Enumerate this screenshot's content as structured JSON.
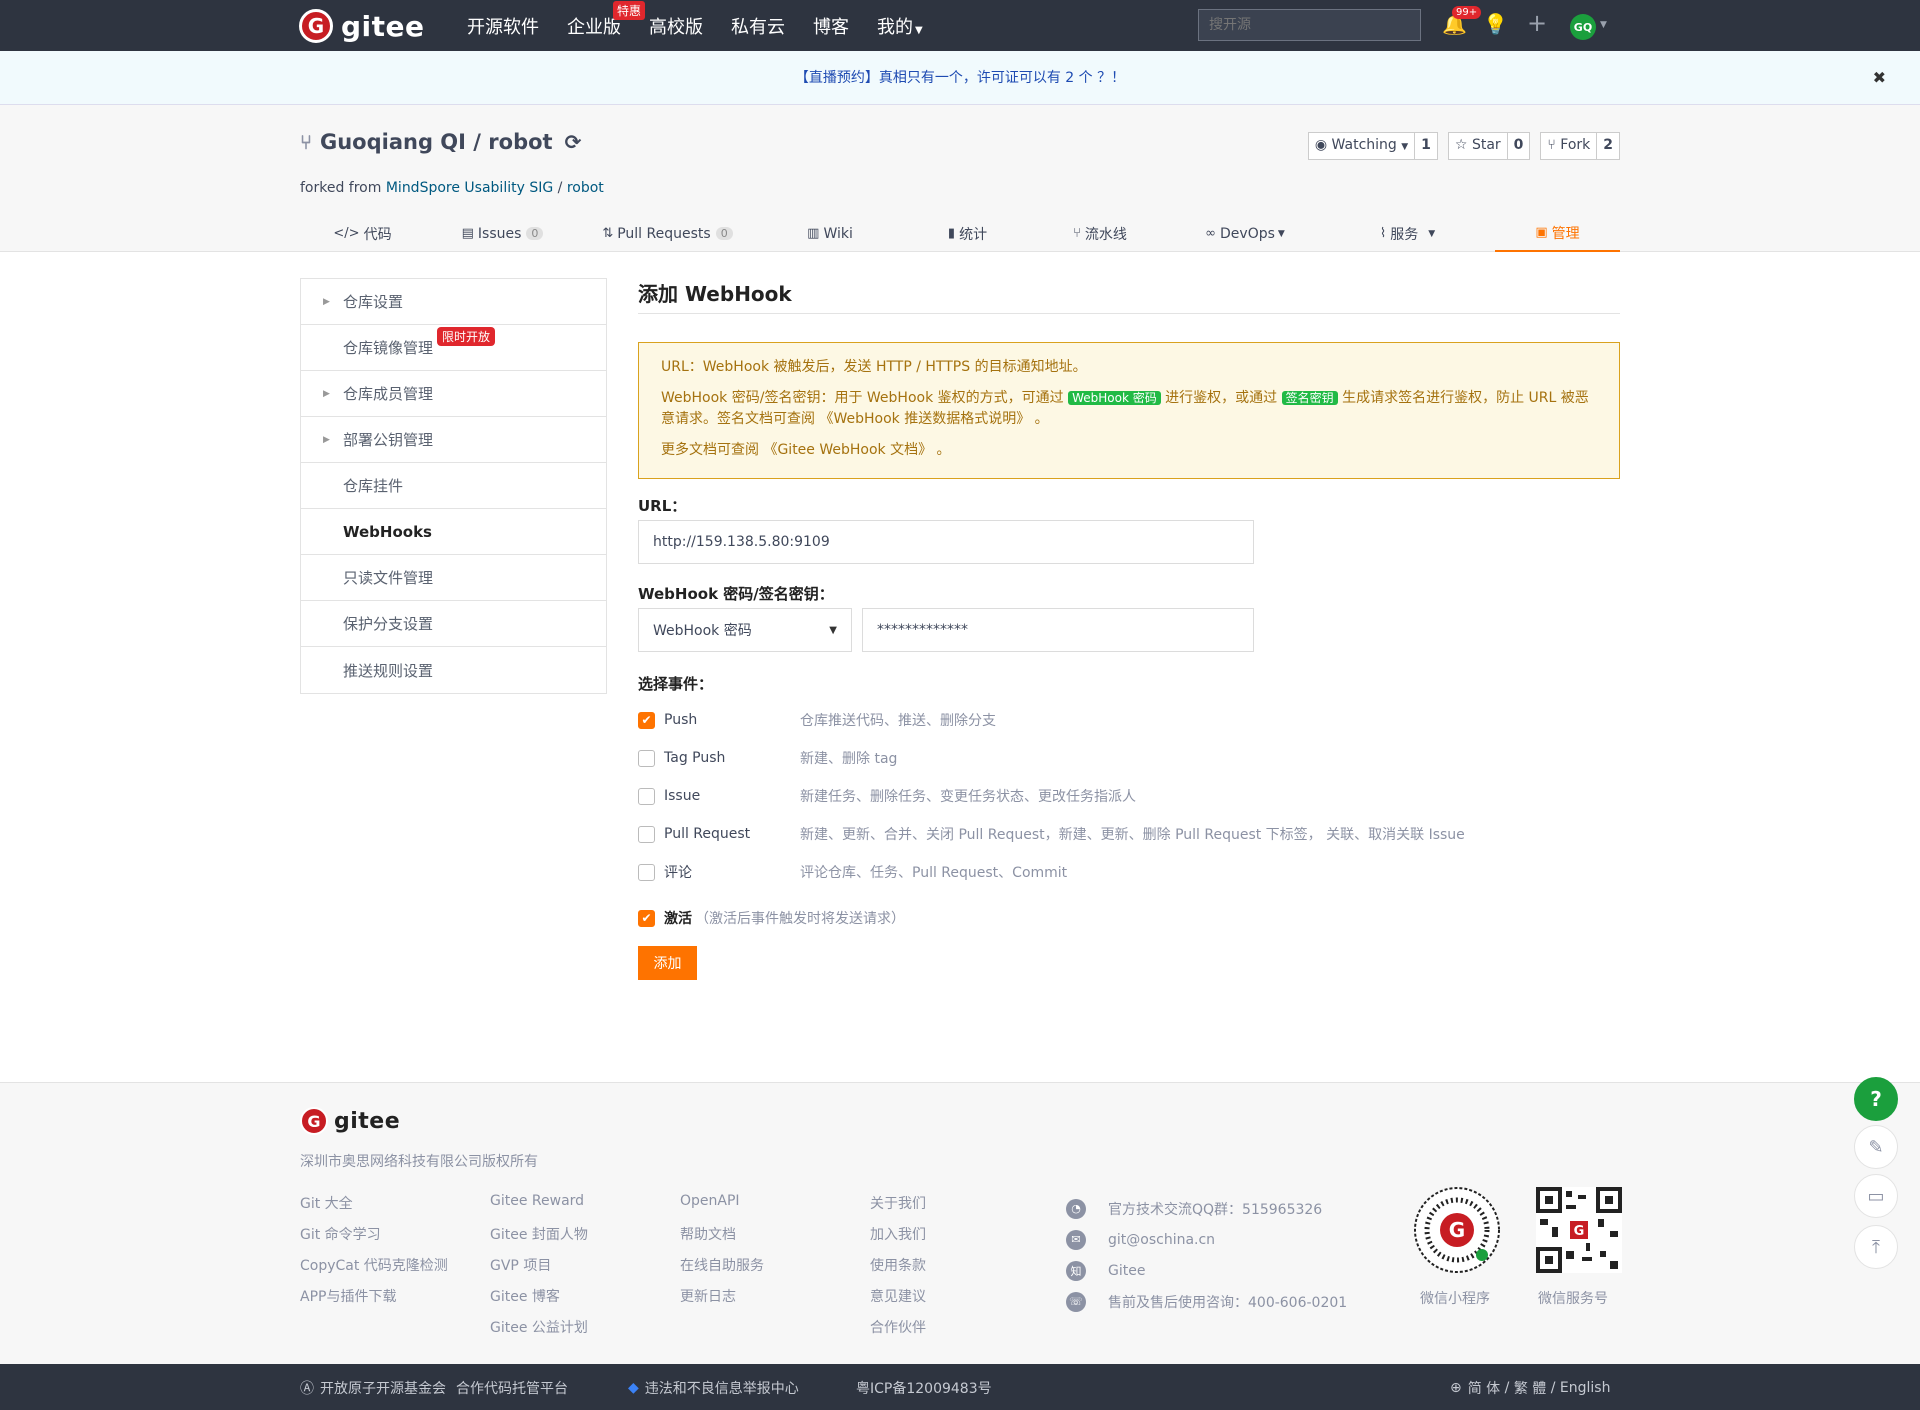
{
  "topnav": {
    "logo_text": "gitee",
    "items": [
      {
        "label": "开源软件"
      },
      {
        "label": "企业版",
        "badge": "特惠"
      },
      {
        "label": "高校版"
      },
      {
        "label": "私有云"
      },
      {
        "label": "博客"
      },
      {
        "label": "我的"
      }
    ],
    "search_placeholder": "搜开源",
    "notification_count": "99+",
    "avatar_initials": "GQ"
  },
  "banner": {
    "text": "【直播预约】真相只有一个，许可证可以有 2 个 ？！",
    "close": "✖"
  },
  "repo": {
    "owner": "Guoqiang QI",
    "separator": " / ",
    "name": "robot",
    "forked_prefix": "forked from ",
    "forked_org": "MindSpore Usability SIG",
    "forked_sep": " / ",
    "forked_repo": "robot",
    "watching_label": "Watching",
    "watching_count": "1",
    "star_label": "Star",
    "star_count": "0",
    "fork_label": "Fork",
    "fork_count": "2",
    "tabs": [
      {
        "icon": "</>",
        "label": "代码"
      },
      {
        "icon": "▤",
        "label": "Issues",
        "count": "0"
      },
      {
        "icon": "⇅",
        "label": "Pull Requests",
        "count": "0"
      },
      {
        "icon": "▥",
        "label": "Wiki"
      },
      {
        "icon": "▮",
        "label": "统计"
      },
      {
        "icon": "⑂",
        "label": "流水线"
      },
      {
        "icon": "∞",
        "label": "DevOps"
      },
      {
        "icon": "⌇",
        "label": "服务"
      },
      {
        "icon": "▣",
        "label": "管理"
      }
    ]
  },
  "sidebar": {
    "items": [
      {
        "label": "仓库设置"
      },
      {
        "label": "仓库镜像管理",
        "badge": "限时开放"
      },
      {
        "label": "仓库成员管理"
      },
      {
        "label": "部署公钥管理"
      },
      {
        "label": "仓库挂件"
      },
      {
        "label": "WebHooks"
      },
      {
        "label": "只读文件管理"
      },
      {
        "label": "保护分支设置"
      },
      {
        "label": "推送规则设置"
      }
    ]
  },
  "form": {
    "title": "添加 WebHook",
    "notice": {
      "line1": "URL：WebHook 被触发后，发送 HTTP / HTTPS 的目标通知地址。",
      "line2_a": "WebHook 密码/签名密钥：用于 WebHook 鉴权的方式，可通过 ",
      "tag1": "WebHook 密码",
      "line2_b": " 进行鉴权，或通过 ",
      "tag2": "签名密钥",
      "line2_c": " 生成请求签名进行鉴权，防止 URL 被恶意请求。签名文档可查阅 ",
      "line2_link": "《WebHook 推送数据格式说明》",
      "line2_d": " 。",
      "line3_a": "更多文档可查阅 ",
      "line3_link": "《Gitee WebHook 文档》",
      "line3_b": " 。"
    },
    "url_label": "URL：",
    "url_value": "http://159.138.5.80:9109",
    "secret_label": "WebHook 密码/签名密钥：",
    "secret_type": "WebHook 密码",
    "secret_value": "*************",
    "events_label": "选择事件：",
    "events": [
      {
        "name": "Push",
        "desc": "仓库推送代码、推送、删除分支",
        "checked": true
      },
      {
        "name": "Tag Push",
        "desc": "新建、删除 tag",
        "checked": false
      },
      {
        "name": "Issue",
        "desc": "新建任务、删除任务、变更任务状态、更改任务指派人",
        "checked": false
      },
      {
        "name": "Pull Request",
        "desc": "新建、更新、合并、关闭 Pull Request，新建、更新、删除 Pull Request 下标签， 关联、取消关联 Issue",
        "checked": false
      },
      {
        "name": "评论",
        "desc": "评论仓库、任务、Pull Request、Commit",
        "checked": false
      }
    ],
    "active_label": "激活",
    "active_hint": "（激活后事件触发时将发送请求）",
    "active_checked": true,
    "submit_label": "添加"
  },
  "footer": {
    "logo_text": "gitee",
    "company": "深圳市奥思网络科技有限公司版权所有",
    "col1": [
      "Git 大全",
      "Git 命令学习",
      "CopyCat 代码克隆检测",
      "APP与插件下载"
    ],
    "col2": [
      "Gitee Reward",
      "Gitee 封面人物",
      "GVP 项目",
      "Gitee 博客",
      "Gitee 公益计划"
    ],
    "col3": [
      "OpenAPI",
      "帮助文档",
      "在线自助服务",
      "更新日志"
    ],
    "col4": [
      "关于我们",
      "加入我们",
      "使用条款",
      "意见建议",
      "合作伙伴"
    ],
    "contacts": [
      {
        "icon": "qq-icon",
        "text": "官方技术交流QQ群：515965326"
      },
      {
        "icon": "mail-icon",
        "text": "git@oschina.cn"
      },
      {
        "icon": "zhihu-icon",
        "glyph": "知",
        "text": "Gitee"
      },
      {
        "icon": "phone-icon",
        "text": "售前及售后使用咨询：400-606-0201"
      }
    ],
    "qr1_label": "微信小程序",
    "qr2_label": "微信服务号"
  },
  "bottombar": {
    "openatom": "开放原子开源基金会",
    "partner": "合作代码托管平台",
    "report": "违法和不良信息举报中心",
    "icp": "粤ICP备12009483号",
    "lang_simplified": "简 体",
    "lang_sep1": " / ",
    "lang_traditional": "繁 體",
    "lang_sep2": " / ",
    "lang_english": "English"
  },
  "colors": {
    "accent": "#fe7300",
    "nav_bg": "#2e3440",
    "brand_red": "#c71d23",
    "success": "#21ba45"
  }
}
